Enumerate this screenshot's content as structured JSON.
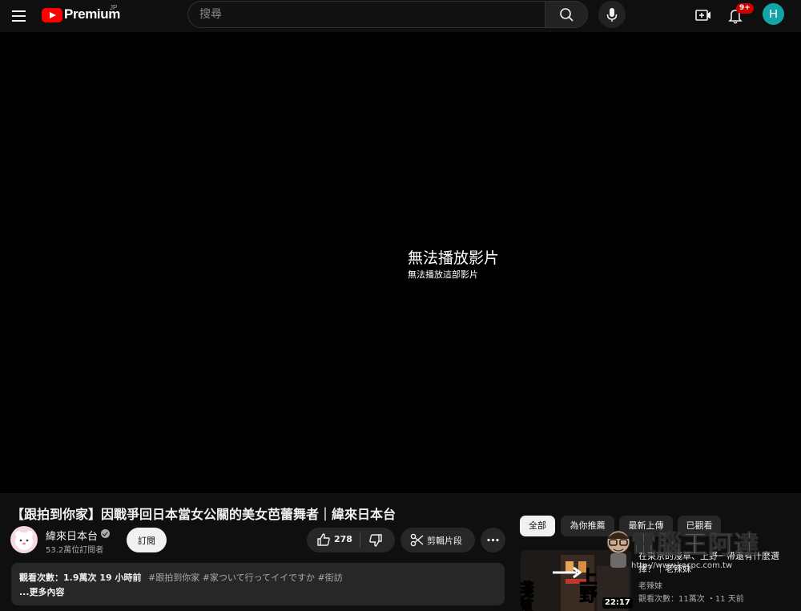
{
  "header": {
    "logo_text": "Premium",
    "region": "JP",
    "search_placeholder": "搜尋",
    "notification_badge": "9+",
    "avatar_letter": "H",
    "icons": [
      "menu-icon",
      "search-icon",
      "mic-icon",
      "create-video-icon",
      "bell-icon"
    ]
  },
  "player": {
    "error_title": "無法播放影片",
    "error_subtitle": "無法播放這部影片"
  },
  "video": {
    "title": "【跟拍到你家】因戰爭回日本當女公關的美女芭蕾舞者｜緯來日本台",
    "channel_name": "緯來日本台",
    "subscribers": "53.2萬位訂閱者",
    "subscribe_label": "訂閱",
    "like_count": "278",
    "clip_label": "剪輯片段",
    "views_time": "觀看次數：1.9萬次  19 小時前",
    "tags": "#跟拍到你家 #家ついて行ってイイですか #街訪",
    "more_label": "...更多內容"
  },
  "chips": [
    {
      "label": "全部",
      "active": true
    },
    {
      "label": "為你推薦",
      "active": false
    },
    {
      "label": "最新上傳",
      "active": false
    },
    {
      "label": "已觀看",
      "active": false
    }
  ],
  "recommendation": {
    "title": "在東京的淺草、上野一帶還有什麼選擇？｜老辣妹",
    "channel": "老辣妹",
    "meta": "觀看次數：11萬次 ・11 天前",
    "duration": "22:17",
    "thumb_text_left": "淺草",
    "thumb_text_right": "上野"
  },
  "watermark": {
    "text": "電腦王阿達",
    "url": "http://www.kocpc.com.tw"
  },
  "colors": {
    "background": "#0f0f0f",
    "player": "#000000",
    "surface": "#272727",
    "brand_red": "#ff0000",
    "badge_red": "#cc0000",
    "avatar_teal": "#12a4a8"
  }
}
